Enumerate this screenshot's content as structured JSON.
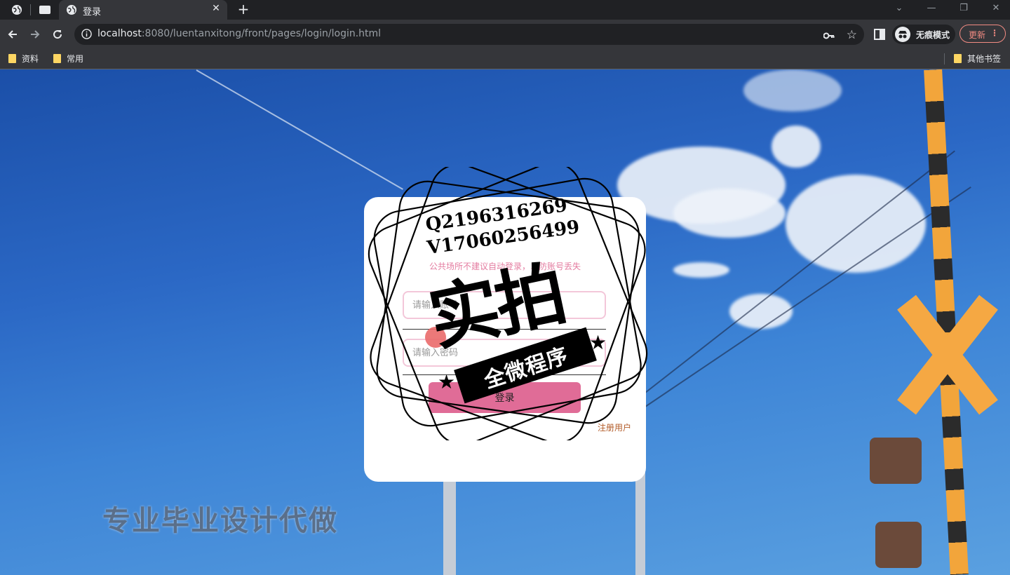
{
  "browser": {
    "tab_title": "登录",
    "url_host": "localhost",
    "url_rest": ":8080/luentanxitong/front/pages/login/login.html",
    "profile_label": "无痕模式",
    "update_label": "更新",
    "bookmarks": [
      "资料",
      "常用"
    ],
    "other_bookmarks": "其他书签"
  },
  "login": {
    "notice": "公共场所不建议自动登录，以防账号丢失",
    "username_placeholder": "请输入账号",
    "password_placeholder": "请输入密码",
    "login_button": "登录",
    "register_link": "注册用户"
  },
  "overlay": {
    "contact_q": "Q2196316269",
    "contact_v": "V17060256499",
    "stamp_word": "实拍",
    "banner": "全微程序",
    "watermark": "专业毕业设计代做"
  }
}
